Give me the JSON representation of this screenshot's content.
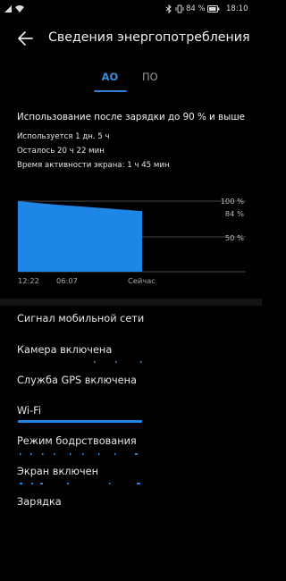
{
  "status_bar": {
    "battery_text": "84 %",
    "time": "18:10",
    "icons": [
      "sim-icon",
      "wifi-icon",
      "bluetooth-icon",
      "vibrate-icon",
      "battery-icon"
    ]
  },
  "header": {
    "title": "Сведения энергопотребления",
    "back_icon": "arrow-left-icon"
  },
  "tabs": [
    {
      "label": "АО",
      "active": true
    },
    {
      "label": "ПО",
      "active": false
    }
  ],
  "usage": {
    "title": "Использование после зарядки до 90 % и выше",
    "used": "Используется 1 дн. 5 ч",
    "remaining": "Осталось 20 ч 22 мин",
    "screen_time": "Время активности экрана: 1 ч 45 мин"
  },
  "chart": {
    "y_ticks": [
      "100 %",
      "84 %",
      "50 %"
    ],
    "x_ticks": [
      "12:22",
      "06:07",
      "Сейчас"
    ]
  },
  "chart_data": {
    "type": "area",
    "title": "",
    "xlabel": "",
    "ylabel": "",
    "x": [
      "12:22",
      "06:07",
      "Сейчас"
    ],
    "series": [
      {
        "values": [
          100,
          95,
          86
        ]
      }
    ],
    "ylim": [
      0,
      100
    ],
    "grid": true,
    "color": "#1d86e6"
  },
  "items": [
    {
      "label": "Сигнал мобильной сети",
      "bar": "none"
    },
    {
      "label": "Камера включена",
      "bar": "marks"
    },
    {
      "label": "Служба GPS включена",
      "bar": "none"
    },
    {
      "label": "Wi-Fi",
      "bar": "full"
    },
    {
      "label": "Режим бодрствования",
      "bar": "marks"
    },
    {
      "label": "Экран включен",
      "bar": "marks"
    },
    {
      "label": "Зарядка",
      "bar": "none"
    }
  ],
  "colors": {
    "accent": "#2f7fd6",
    "background": "#000000",
    "chart_fill": "#1d86e6"
  }
}
